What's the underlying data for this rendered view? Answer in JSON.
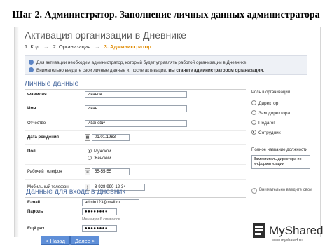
{
  "slide_title": "Шаг 2. Администратор. Заполнение личных данных администратора",
  "app_title": "Активация организации в Дневнике",
  "steps": {
    "step1": "1. Код",
    "step2": "2. Организация",
    "step3": "3. Администратор",
    "separator": "→"
  },
  "info": {
    "line1": "Для активации необходим администратор, который будет управлять работой организации в Дневнике.",
    "line2_prefix": "Внимательно введите свои личные данные и, после активации,",
    "line2_bold": "вы станете администратором организации."
  },
  "personal": {
    "heading": "Личные данные",
    "surname_label": "Фамилия",
    "surname_value": "Иванов",
    "name_label": "Имя",
    "name_value": "Иван",
    "patronymic_label": "Отчество",
    "patronymic_value": "Иванович",
    "birthdate_label": "Дата рождения",
    "birthdate_value": "01.01.1983",
    "gender_label": "Пол",
    "gender_male": "Мужской",
    "gender_female": "Женский",
    "work_phone_label": "Рабочий телефон",
    "work_phone_value": "55-55-55",
    "mobile_label": "Мобильный телефон",
    "mobile_value": "8-928-990-12-34"
  },
  "login": {
    "heading": "Данные для входа в Дневник",
    "email_label": "E-mail",
    "email_value": "admin123@mail.ru",
    "password_label": "Пароль",
    "password_value": "●●●●●●●●",
    "password_hint": "Минимум 6 символов",
    "repeat_label": "Ещё раз",
    "repeat_value": "●●●●●●●●"
  },
  "role": {
    "heading": "Роль в организации",
    "options": [
      "Директор",
      "Зам.директора",
      "Педагог",
      "Сотрудник"
    ],
    "position_label": "Полное название должности",
    "position_value": "Заместитель директора по информатизации"
  },
  "warning": {
    "text": "Внимательно введите свои"
  },
  "buttons": {
    "back": "< Назад",
    "next": "Далее >"
  },
  "brand": {
    "name": "MyShared",
    "url": "www.myshared.ru"
  },
  "colors": {
    "accent_orange": "#e08a00",
    "heading_blue": "#4f6fa3",
    "button_blue": "#5f8fd8",
    "info_bg": "#eef1f6"
  }
}
